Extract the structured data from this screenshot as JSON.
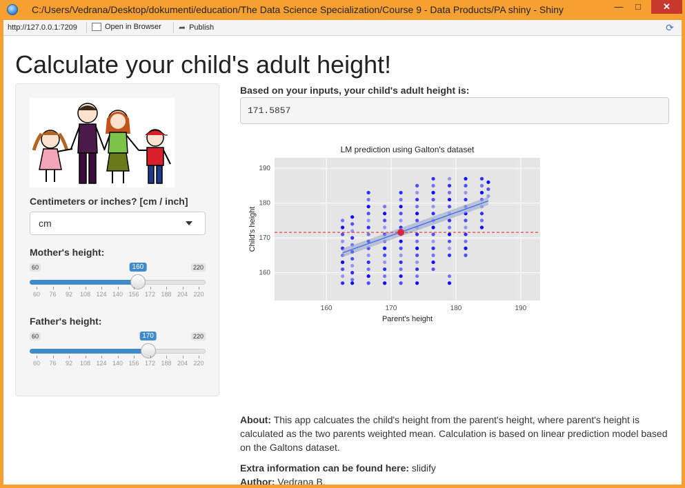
{
  "window": {
    "title": "C:/Users/Vedrana/Desktop/dokumenti/education/The Data Science Specialization/Course 9 - Data Products/PA shiny - Shiny",
    "min_label": "—",
    "max_label": "□",
    "close_label": "✕"
  },
  "toolbar": {
    "url": "http://127.0.0.1:7209",
    "open_browser_label": "Open in Browser",
    "publish_label": "Publish"
  },
  "page": {
    "title": "Calculate your child's adult height!"
  },
  "sidebar": {
    "units_label": "Centimeters or inches? [cm / inch]",
    "units_value": "cm",
    "mother": {
      "label": "Mother's height:",
      "min": 60,
      "max": 220,
      "value": 160,
      "ticks": [
        "60",
        "76",
        "92",
        "108",
        "124",
        "140",
        "156",
        "172",
        "188",
        "204",
        "220"
      ]
    },
    "father": {
      "label": "Father's height:",
      "min": 60,
      "max": 220,
      "value": 170,
      "ticks": [
        "60",
        "76",
        "92",
        "108",
        "124",
        "140",
        "156",
        "172",
        "188",
        "204",
        "220"
      ]
    }
  },
  "result": {
    "label": "Based on your inputs, your child's adult height is:",
    "value": "171.5857"
  },
  "chart_data": {
    "type": "scatter",
    "title": "LM prediction using Galton's dataset",
    "xlabel": "Parent's height",
    "ylabel": "Child's height",
    "xlim": [
      152,
      193
    ],
    "ylim": [
      152,
      193
    ],
    "xticks": [
      160,
      170,
      180,
      190
    ],
    "yticks": [
      160,
      170,
      180,
      190
    ],
    "grid": true,
    "background": "#e5e5e5",
    "point_color": "#0000ff",
    "regression": {
      "x": [
        162.5,
        185.0
      ],
      "y": [
        165.7,
        180.6
      ]
    },
    "prediction_line_y": 171.5857,
    "prediction_point": {
      "x": 171.5,
      "y": 171.5857
    },
    "columns": [
      {
        "x": 162.5,
        "y": [
          157,
          159,
          161,
          163,
          165,
          167,
          169,
          171,
          173,
          175
        ]
      },
      {
        "x": 164.0,
        "y": [
          157,
          158,
          160,
          162,
          164,
          166,
          168,
          170,
          172,
          174,
          176
        ]
      },
      {
        "x": 166.5,
        "y": [
          157,
          159,
          161,
          163,
          165,
          167,
          169,
          171,
          173,
          175,
          177,
          179,
          181,
          183
        ]
      },
      {
        "x": 169.0,
        "y": [
          157,
          159,
          161,
          163,
          165,
          167,
          169,
          171,
          173,
          175,
          177,
          179
        ]
      },
      {
        "x": 171.5,
        "y": [
          157,
          159,
          161,
          163,
          165,
          167,
          169,
          171,
          173,
          175,
          177,
          179,
          181,
          183
        ]
      },
      {
        "x": 174.0,
        "y": [
          157,
          159,
          161,
          163,
          165,
          167,
          169,
          171,
          173,
          175,
          177,
          179,
          181,
          183,
          185
        ]
      },
      {
        "x": 176.5,
        "y": [
          161,
          163,
          165,
          167,
          169,
          171,
          173,
          175,
          177,
          179,
          181,
          183,
          185,
          187
        ]
      },
      {
        "x": 179.0,
        "y": [
          157,
          159,
          165,
          167,
          169,
          171,
          173,
          175,
          177,
          179,
          181,
          183,
          185,
          187
        ]
      },
      {
        "x": 181.5,
        "y": [
          165,
          167,
          169,
          171,
          173,
          175,
          177,
          179,
          181,
          183,
          185,
          187
        ]
      },
      {
        "x": 184.0,
        "y": [
          173,
          175,
          177,
          179,
          181,
          183,
          185,
          187
        ]
      },
      {
        "x": 185.0,
        "y": [
          182,
          184,
          186
        ]
      }
    ]
  },
  "about": {
    "about_label": "About:",
    "about_text": " This app calcuates the child's height from the parent's height, where parent's height is calculated as the two parents weighted mean. Calculation is based on linear prediction model based on the Galtons dataset.",
    "extra_label": "Extra information can be found here:",
    "extra_value": " slidify",
    "author_label": "Author:",
    "author_value": " Vedrana B."
  }
}
